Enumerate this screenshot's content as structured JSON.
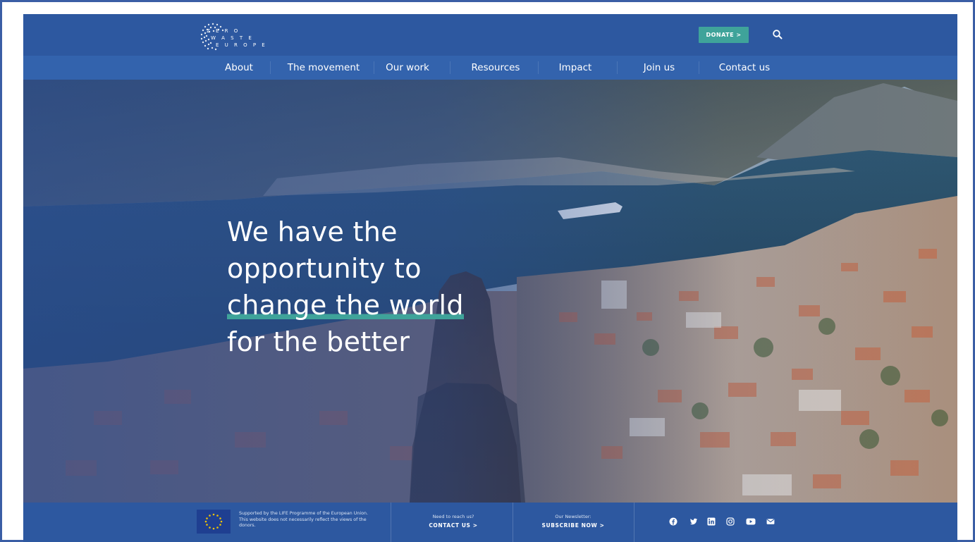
{
  "brand": {
    "logo_lines": [
      "Z E R O",
      "W A S T E",
      "E U R O P E"
    ]
  },
  "header": {
    "donate_label": "DONATE >",
    "search_icon": "search-icon"
  },
  "nav": {
    "items": [
      "About",
      "The movement",
      "Our work",
      "Resources",
      "Impact",
      "Join us",
      "Contact us"
    ]
  },
  "hero": {
    "headline_lines": [
      "We have the",
      "opportunity to",
      "change the world",
      "for the better"
    ],
    "highlight_color": "#3fa39a"
  },
  "footer": {
    "eu_text": "Supported by the LIFE Programme of the European Union. This website does not necessarily reflect the views of the donors.",
    "contact": {
      "small": "Need to reach us?",
      "cta": "CONTACT US >"
    },
    "newsletter": {
      "small": "Our Newsletter:",
      "cta": "SUBSCRIBE NOW >"
    },
    "social_icons": [
      "facebook-icon",
      "twitter-icon",
      "linkedin-icon",
      "instagram-icon",
      "youtube-icon",
      "email-icon"
    ]
  },
  "colors": {
    "primary": "#2d58a0",
    "nav_bar": "#3363ad",
    "accent": "#3fa39a"
  }
}
